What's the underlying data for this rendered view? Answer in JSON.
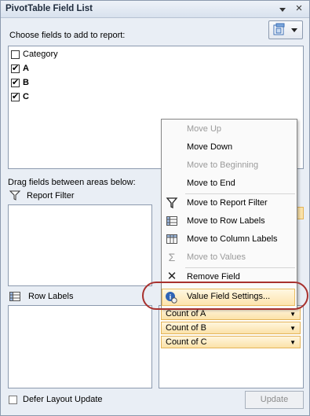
{
  "window": {
    "title": "PivotTable Field List",
    "close_glyph": "×"
  },
  "chooser": {
    "label": "Choose fields to add to report:"
  },
  "fields": [
    {
      "label": "Category",
      "checked": false,
      "bold": false
    },
    {
      "label": "A",
      "checked": true,
      "bold": true
    },
    {
      "label": "B",
      "checked": true,
      "bold": true
    },
    {
      "label": "C",
      "checked": true,
      "bold": true
    }
  ],
  "areas": {
    "drag_label": "Drag fields between areas below:",
    "report_filter": "Report Filter",
    "row_labels": "Row Labels"
  },
  "values": [
    "Count of A",
    "Count of B",
    "Count of C"
  ],
  "defer": {
    "label": "Defer Layout Update",
    "checked": false
  },
  "update_button": "Update",
  "context_menu": {
    "items": [
      {
        "label": "Move Up",
        "disabled": true,
        "icon": ""
      },
      {
        "label": "Move Down",
        "disabled": false,
        "icon": ""
      },
      {
        "label": "Move to Beginning",
        "disabled": true,
        "icon": ""
      },
      {
        "label": "Move to End",
        "disabled": false,
        "icon": ""
      },
      {
        "label": "Move to Report Filter",
        "disabled": false,
        "icon": "filter-icon"
      },
      {
        "label": "Move to Row Labels",
        "disabled": false,
        "icon": "row-labels-icon"
      },
      {
        "label": "Move to Column Labels",
        "disabled": false,
        "icon": "column-labels-icon"
      },
      {
        "label": "Move to Values",
        "disabled": true,
        "icon": "sigma-icon"
      },
      {
        "label": "Remove Field",
        "disabled": false,
        "icon": "remove-icon"
      },
      {
        "label": "Value Field Settings...",
        "disabled": false,
        "icon": "info-settings-icon"
      }
    ],
    "sigma_glyph": "Σ",
    "remove_glyph": "✕"
  },
  "colors": {
    "highlight_ring": "#a8312e",
    "value_pill": "#fbe2a8"
  }
}
